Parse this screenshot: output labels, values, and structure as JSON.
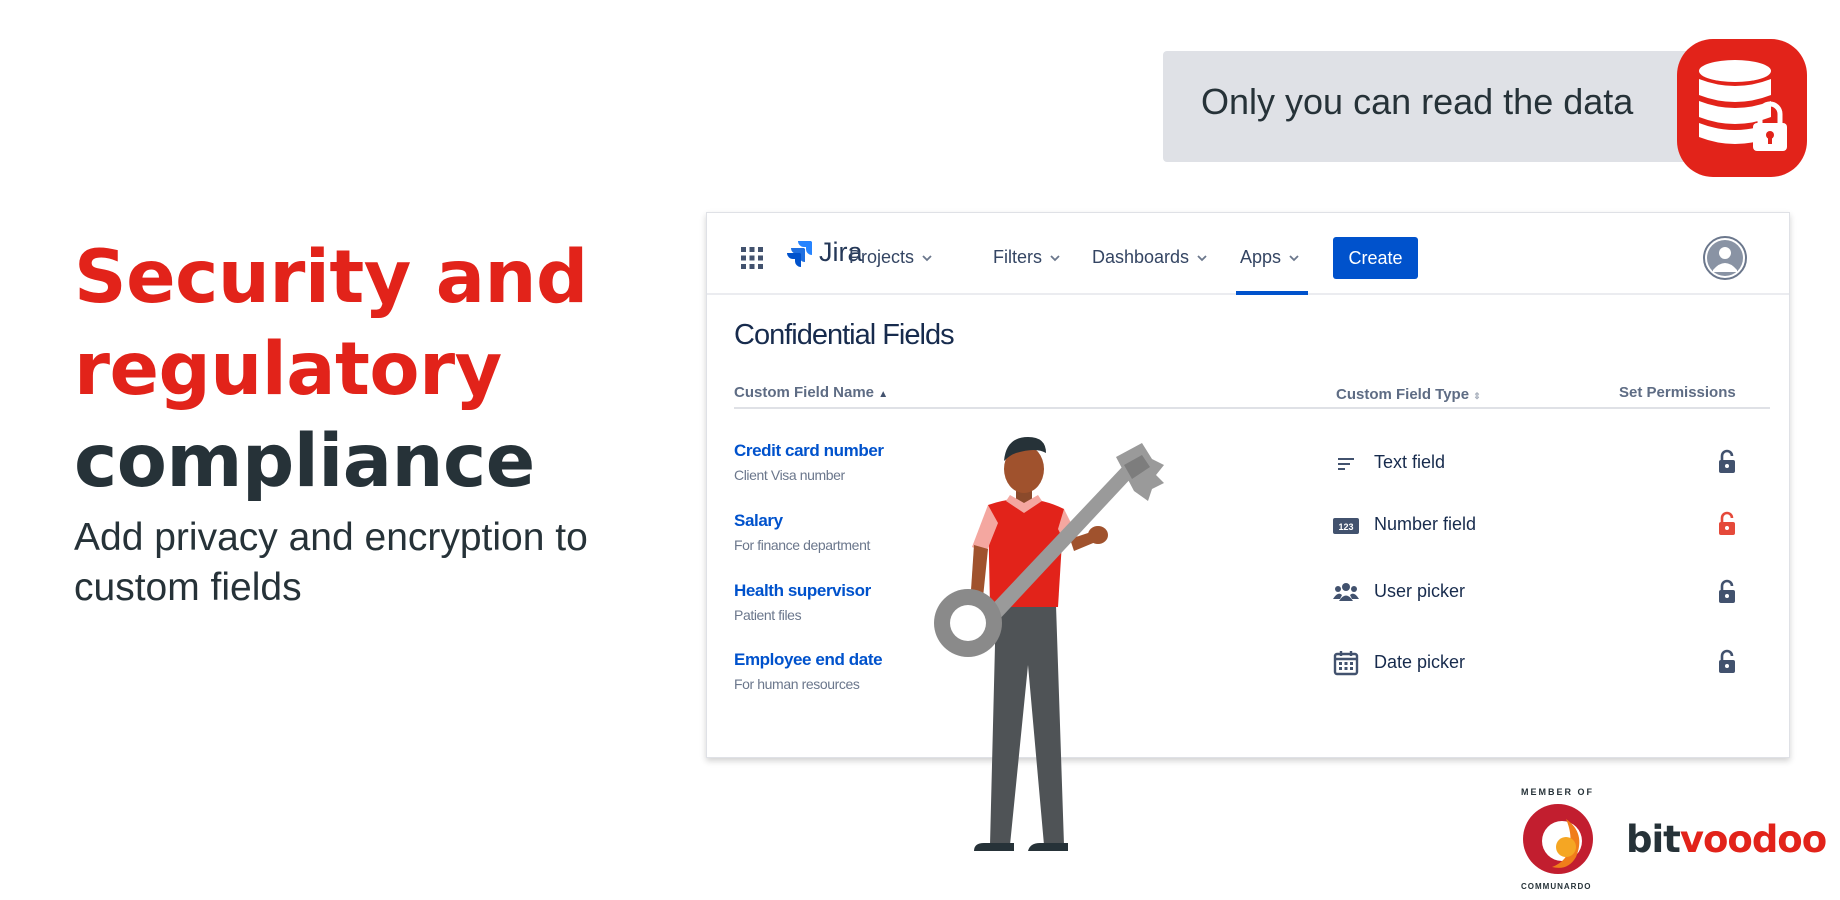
{
  "hero": {
    "headline_red": "Security and regulatory",
    "headline_red_line1": "Security and",
    "headline_red_line2": "regulatory",
    "headline_dark": "compliance",
    "subtitle": "Add privacy and encryption to custom fields"
  },
  "banner": {
    "text": "Only you can read the data",
    "icon": "database-lock-icon",
    "color": "#e2231a"
  },
  "jira": {
    "brand": "Jira",
    "nav": [
      {
        "label": "Projects"
      },
      {
        "label": "Filters"
      },
      {
        "label": "Dashboards"
      },
      {
        "label": "Apps",
        "active": true
      }
    ],
    "create_label": "Create",
    "accent": "#0052cc",
    "page_title": "Confidential Fields",
    "columns": {
      "name": "Custom Field Name",
      "type": "Custom Field Type",
      "permissions": "Set Permissions"
    },
    "rows": [
      {
        "name": "Credit card number",
        "description": "Client Visa number",
        "type": "Text field",
        "type_icon": "text-lines-icon",
        "lock_color": "#42526e"
      },
      {
        "name": "Salary",
        "description": "For finance department",
        "type": "Number field",
        "type_icon": "number-123-icon",
        "lock_color": "#e5493a"
      },
      {
        "name": "Health supervisor",
        "description": "Patient files",
        "type": "User picker",
        "type_icon": "people-icon",
        "lock_color": "#42526e"
      },
      {
        "name": "Employee end date",
        "description": "For human resources",
        "type": "Date picker",
        "type_icon": "calendar-icon",
        "lock_color": "#42526e"
      }
    ]
  },
  "logos": {
    "member_of": "MEMBER OF",
    "communardo": "COMMUNARDO",
    "bit": "bit",
    "voodoo": "voodoo"
  }
}
